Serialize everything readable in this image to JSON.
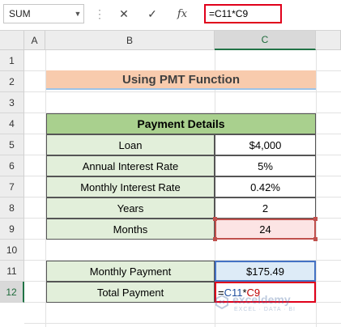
{
  "formula_bar": {
    "name_box": "SUM",
    "cancel_icon": "✕",
    "enter_icon": "✓",
    "fx_label": "fx",
    "formula": "=C11*C9"
  },
  "columns": [
    "A",
    "B",
    "C"
  ],
  "rows": [
    "1",
    "2",
    "3",
    "4",
    "5",
    "6",
    "7",
    "8",
    "9",
    "10",
    "11",
    "12"
  ],
  "sheet": {
    "title": "Using PMT Function",
    "payment_details_header": "Payment Details",
    "details": [
      {
        "label": "Loan",
        "value": "$4,000"
      },
      {
        "label": "Annual Interest Rate",
        "value": "5%"
      },
      {
        "label": "Monthly Interest Rate",
        "value": "0.42%"
      },
      {
        "label": "Years",
        "value": "2"
      },
      {
        "label": "Months",
        "value": "24"
      }
    ],
    "monthly_payment_label": "Monthly Payment",
    "monthly_payment_value": "$175.49",
    "total_payment_label": "Total Payment",
    "total_payment_formula": {
      "prefix": "=",
      "ref1": "C11",
      "op": "*",
      "ref2": "C9"
    }
  },
  "watermark": {
    "name": "exceldemy",
    "tagline": "EXCEL · DATA · BI"
  },
  "colors": {
    "accent": "#217346",
    "title_fill": "#f8cbad",
    "header_fill": "#a9d08e",
    "label_fill": "#e2efda",
    "highlight_red": "#e0001b"
  }
}
